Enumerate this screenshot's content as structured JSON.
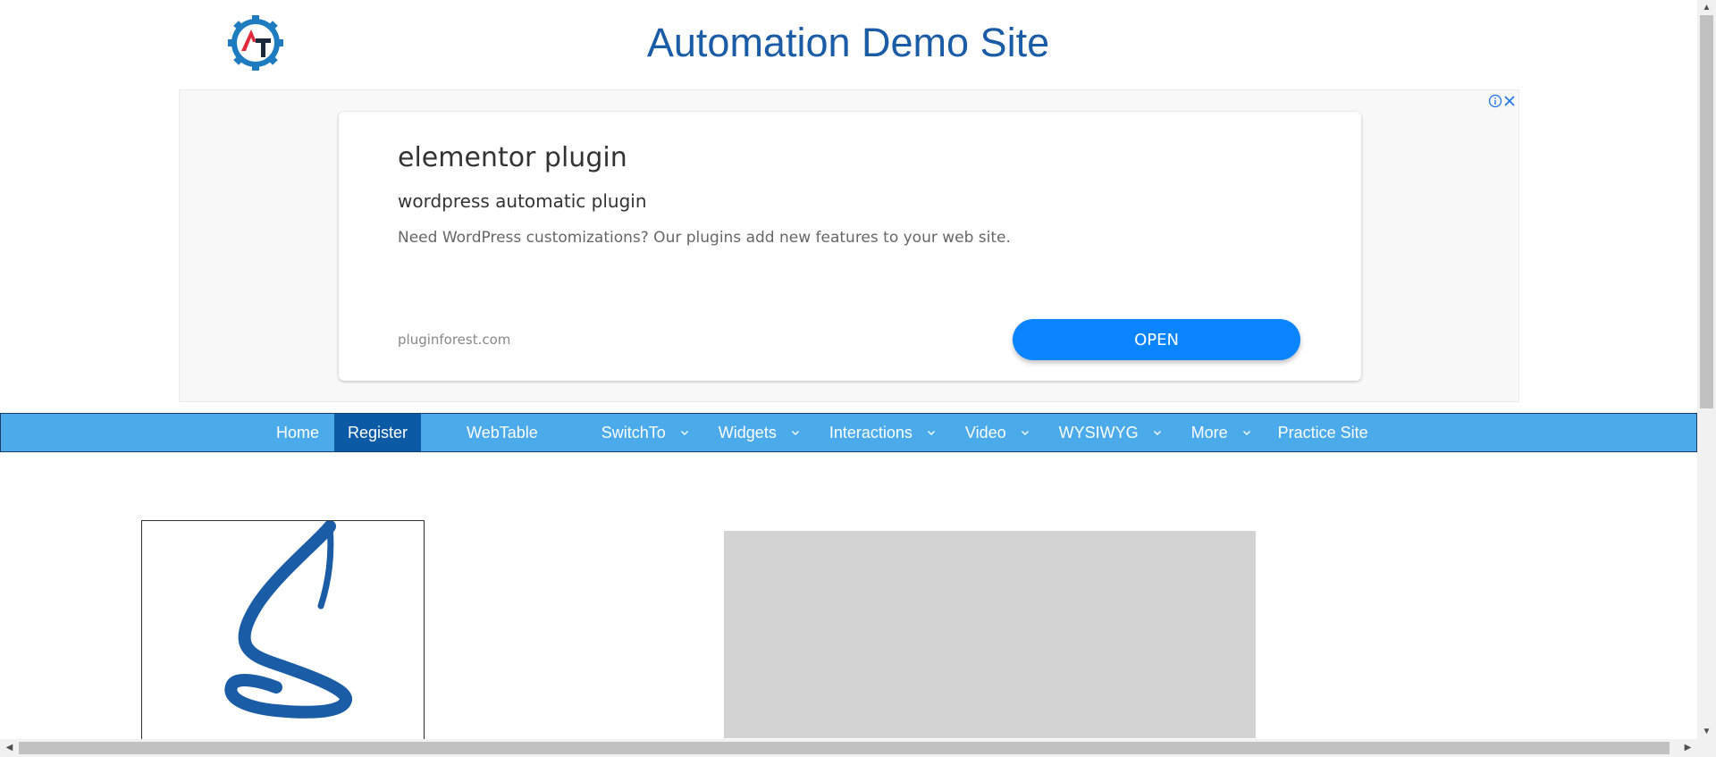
{
  "header": {
    "title": "Automation Demo Site",
    "logo_icon": "gear-at-logo-icon",
    "logo_letters": "AT"
  },
  "ad": {
    "headline": "elementor plugin",
    "subheadline": "wordpress automatic plugin",
    "description": "Need WordPress customizations? Our plugins add new features to your web site.",
    "domain": "pluginforest.com",
    "open_label": "OPEN",
    "accent_color": "#0a84ff"
  },
  "nav": {
    "items": [
      {
        "label": "Home",
        "has_dropdown": false,
        "active": false
      },
      {
        "label": "Register",
        "has_dropdown": false,
        "active": true
      },
      {
        "label": "WebTable",
        "has_dropdown": false,
        "active": false
      },
      {
        "label": "SwitchTo",
        "has_dropdown": true,
        "active": false
      },
      {
        "label": "Widgets",
        "has_dropdown": true,
        "active": false
      },
      {
        "label": "Interactions",
        "has_dropdown": true,
        "active": false
      },
      {
        "label": "Video",
        "has_dropdown": true,
        "active": false
      },
      {
        "label": "WYSIWYG",
        "has_dropdown": true,
        "active": false
      },
      {
        "label": "More",
        "has_dropdown": true,
        "active": false
      },
      {
        "label": "Practice Site",
        "has_dropdown": false,
        "active": false
      }
    ],
    "bar_color": "#4aaaea",
    "active_color": "#0b5aa6"
  },
  "content": {
    "signature_icon": "signature-s-logo-icon",
    "video_placeholder_color": "#d3d3d3"
  }
}
